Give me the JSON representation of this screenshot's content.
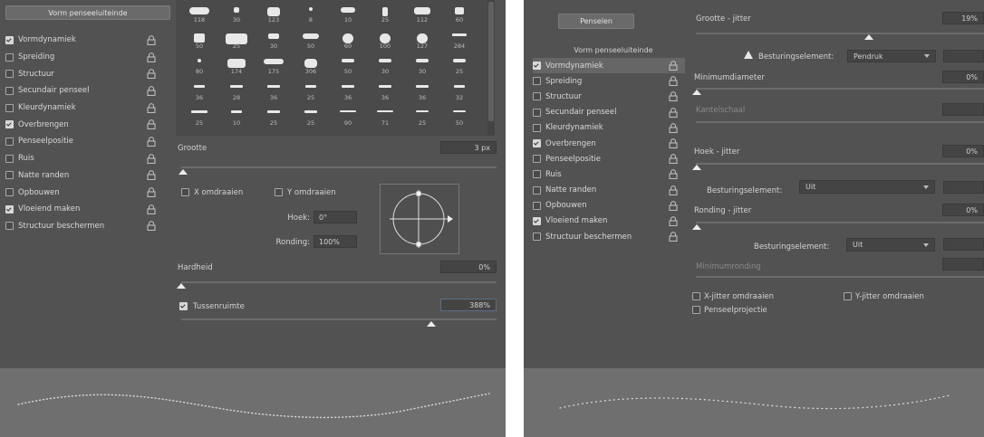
{
  "left": {
    "tab_label": "Vorm penseeluiteinde",
    "options": [
      {
        "label": "Vormdynamiek",
        "checked": true
      },
      {
        "label": "Spreiding",
        "checked": false
      },
      {
        "label": "Structuur",
        "checked": false
      },
      {
        "label": "Secundair penseel",
        "checked": false
      },
      {
        "label": "Kleurdynamiek",
        "checked": false
      },
      {
        "label": "Overbrengen",
        "checked": true
      },
      {
        "label": "Penseelpositie",
        "checked": false
      },
      {
        "label": "Ruis",
        "checked": false
      },
      {
        "label": "Natte randen",
        "checked": false
      },
      {
        "label": "Opbouwen",
        "checked": false
      },
      {
        "label": "Vloeiend maken",
        "checked": true
      },
      {
        "label": "Structuur beschermen",
        "checked": false
      }
    ],
    "brush_sizes": [
      [
        "118",
        "30",
        "123",
        "8",
        "10",
        "25",
        "112",
        "60"
      ],
      [
        "50",
        "25",
        "30",
        "50",
        "60",
        "100",
        "127",
        "284"
      ],
      [
        "80",
        "174",
        "175",
        "306",
        "50",
        "30",
        "30",
        "25"
      ],
      [
        "36",
        "28",
        "36",
        "25",
        "36",
        "36",
        "36",
        "32"
      ],
      [
        "25",
        "10",
        "25",
        "25",
        "90",
        "71",
        "25",
        "50"
      ]
    ],
    "size_label": "Grootte",
    "size_value": "3 px",
    "flip_x_label": "X omdraaien",
    "flip_y_label": "Y omdraaien",
    "angle_label": "Hoek:",
    "angle_value": "0°",
    "roundness_label": "Ronding:",
    "roundness_value": "100%",
    "hardness_label": "Hardheid",
    "hardness_value": "0%",
    "spacing_label": "Tussenruimte",
    "spacing_value": "388%",
    "spacing_checked": true
  },
  "right": {
    "tab_label": "Penselen",
    "list_header": "Vorm penseeluiteinde",
    "options": [
      {
        "label": "Vormdynamiek",
        "checked": true
      },
      {
        "label": "Spreiding",
        "checked": false
      },
      {
        "label": "Structuur",
        "checked": false
      },
      {
        "label": "Secundair penseel",
        "checked": false
      },
      {
        "label": "Kleurdynamiek",
        "checked": false
      },
      {
        "label": "Overbrengen",
        "checked": true
      },
      {
        "label": "Penseelpositie",
        "checked": false
      },
      {
        "label": "Ruis",
        "checked": false
      },
      {
        "label": "Natte randen",
        "checked": false
      },
      {
        "label": "Opbouwen",
        "checked": false
      },
      {
        "label": "Vloeiend maken",
        "checked": true
      },
      {
        "label": "Structuur beschermen",
        "checked": false
      }
    ],
    "size_jitter_label": "Grootte - jitter",
    "size_jitter_value": "19%",
    "control_label": "Besturingselement:",
    "control_value_1": "Pendruk",
    "min_diameter_label": "Minimumdiameter",
    "min_diameter_value": "0%",
    "tilt_scale_label": "Kantelschaal",
    "angle_jitter_label": "Hoek - jitter",
    "angle_jitter_value": "0%",
    "control_value_2": "Uit",
    "roundness_jitter_label": "Ronding - jitter",
    "roundness_jitter_value": "0%",
    "control_value_3": "Uit",
    "min_roundness_label": "Minimumronding",
    "flip_x_jitter_label": "X-jitter omdraaien",
    "flip_y_jitter_label": "Y-jitter omdraaien",
    "brush_projection_label": "Penseelprojectie"
  },
  "colors": {
    "panel": "#525252",
    "preview": "#6f6f6f",
    "field": "#444444",
    "text": "#d6d6d6"
  }
}
